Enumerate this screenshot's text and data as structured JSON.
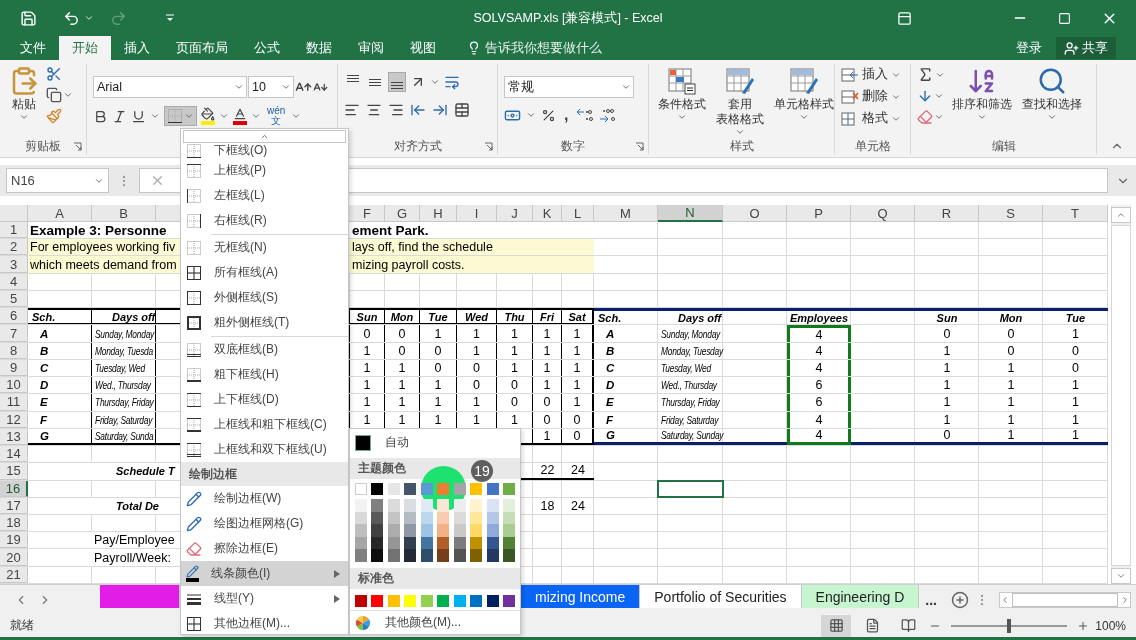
{
  "title": "SOLVSAMP.xls  [兼容模式] - Excel",
  "quick_access": {
    "redo_disabled": true
  },
  "menu_tabs": [
    {
      "label": "文件",
      "selected": false
    },
    {
      "label": "开始",
      "selected": true
    },
    {
      "label": "插入",
      "selected": false
    },
    {
      "label": "页面布局",
      "selected": false
    },
    {
      "label": "公式",
      "selected": false
    },
    {
      "label": "数据",
      "selected": false
    },
    {
      "label": "审阅",
      "selected": false
    },
    {
      "label": "视图",
      "selected": false
    }
  ],
  "tell_me": "告诉我你想要做什么",
  "sign_in": "登录",
  "share": "共享",
  "ribbon": {
    "groups": [
      {
        "kind": "clipboard",
        "label": "剪贴板",
        "paste": "粘贴"
      },
      {
        "kind": "font",
        "font": "Arial",
        "size": "10",
        "border_open": true,
        "phonetic": [
          "wén",
          "文"
        ]
      },
      {
        "kind": "alignment",
        "label": "对齐方式",
        "vertical_align": [
          {
            "selected": false
          },
          {
            "selected": false
          },
          {
            "selected": true
          }
        ]
      },
      {
        "kind": "number",
        "label": "数字",
        "format": "常规",
        "comma": ","
      },
      {
        "kind": "styles",
        "label": "样式",
        "buttons": [
          {
            "kind": "conditional",
            "lines": [
              "条件格式"
            ]
          },
          {
            "kind": "table",
            "lines": [
              "套用",
              "表格格式"
            ]
          },
          {
            "kind": "cell_style",
            "lines": [
              "单元格样式"
            ]
          }
        ]
      },
      {
        "kind": "cells",
        "label": "单元格",
        "items": [
          {
            "kind": "insert",
            "label": "插入"
          },
          {
            "kind": "delete",
            "label": "删除"
          },
          {
            "kind": "format",
            "label": "格式"
          }
        ]
      },
      {
        "kind": "editing",
        "label": "编辑",
        "buttons": [
          {
            "kind": "sort",
            "label": "排序和筛选"
          },
          {
            "kind": "find",
            "label": "查找和选择"
          }
        ]
      }
    ]
  },
  "name_box": "N16",
  "sheet": {
    "column_headers": [
      {
        "label": "A",
        "selected": false
      },
      {
        "label": "B",
        "selected": false
      },
      {
        "label": "F",
        "selected": false
      },
      {
        "label": "G",
        "selected": false
      },
      {
        "label": "H",
        "selected": false
      },
      {
        "label": "I",
        "selected": false
      },
      {
        "label": "J",
        "selected": false
      },
      {
        "label": "K",
        "selected": false
      },
      {
        "label": "L",
        "selected": false
      },
      {
        "label": "M",
        "selected": false
      },
      {
        "label": "N",
        "selected": true
      },
      {
        "label": "O",
        "selected": false
      },
      {
        "label": "P",
        "selected": false
      },
      {
        "label": "Q",
        "selected": false
      },
      {
        "label": "R",
        "selected": false
      },
      {
        "label": "S",
        "selected": false
      },
      {
        "label": "T",
        "selected": false
      }
    ],
    "rows": [
      {
        "header": "1",
        "selected": false,
        "kind": "title",
        "cells": [
          "Example 3:  Personne",
          null,
          "ement Park.",
          null,
          null,
          null,
          null,
          null,
          null,
          null,
          null,
          null,
          null,
          null,
          null,
          null,
          null
        ]
      },
      {
        "header": "2",
        "selected": false,
        "kind": "note",
        "cells": [
          "For employees working fiv",
          null,
          "lays off, find the schedule",
          null,
          null,
          null,
          null,
          null,
          null,
          null,
          null,
          null,
          null,
          null,
          null,
          null,
          null
        ]
      },
      {
        "header": "3",
        "selected": false,
        "kind": "note",
        "cells": [
          "which meets demand from",
          null,
          "mizing payroll costs.",
          null,
          null,
          null,
          null,
          null,
          null,
          null,
          null,
          null,
          null,
          null,
          null,
          null,
          null
        ]
      },
      {
        "header": "4",
        "selected": false,
        "kind": "blank"
      },
      {
        "header": "5",
        "selected": false,
        "kind": "blank"
      },
      {
        "header": "6",
        "selected": false,
        "kind": "header",
        "cells": [
          "Sch.",
          "Days off",
          "Sun",
          "Mon",
          "Tue",
          "Wed",
          "Thu",
          "Fri",
          "Sat",
          "Sch.",
          "Days off",
          null,
          "Employees",
          null,
          "Sun",
          "Mon",
          "Tue"
        ]
      },
      {
        "header": "7",
        "selected": false,
        "kind": "data",
        "cells": [
          "A",
          "Sunday, Monday",
          "0",
          "0",
          "1",
          "1",
          "1",
          "1",
          "1",
          "A",
          "Sunday, Monday",
          null,
          "4",
          null,
          "0",
          "0",
          "1"
        ]
      },
      {
        "header": "8",
        "selected": false,
        "kind": "data",
        "cells": [
          "B",
          "Monday, Tuesda",
          "1",
          "0",
          "0",
          "1",
          "1",
          "1",
          "1",
          "B",
          "Monday, Tuesday",
          null,
          "4",
          null,
          "1",
          "0",
          "0"
        ]
      },
      {
        "header": "9",
        "selected": false,
        "kind": "data",
        "cells": [
          "C",
          "Tuesday, Wed",
          "1",
          "1",
          "0",
          "0",
          "1",
          "1",
          "1",
          "C",
          "Tuesday, Wed",
          null,
          "4",
          null,
          "1",
          "1",
          "0"
        ]
      },
      {
        "header": "10",
        "selected": false,
        "kind": "data",
        "cells": [
          "D",
          "Wed., Thursday",
          "1",
          "1",
          "1",
          "0",
          "0",
          "1",
          "1",
          "D",
          "Wed., Thursday",
          null,
          "6",
          null,
          "1",
          "1",
          "1"
        ]
      },
      {
        "header": "11",
        "selected": false,
        "kind": "data",
        "cells": [
          "E",
          "Thursday, Friday",
          "1",
          "1",
          "1",
          "1",
          "0",
          "0",
          "1",
          "E",
          "Thursday, Friday",
          null,
          "6",
          null,
          "1",
          "1",
          "1"
        ]
      },
      {
        "header": "12",
        "selected": false,
        "kind": "data",
        "cells": [
          "F",
          "Friday, Saturday",
          "1",
          "1",
          "1",
          "1",
          "1",
          "0",
          "0",
          "F",
          "Friday, Saturday",
          null,
          "4",
          null,
          "1",
          "1",
          "1"
        ]
      },
      {
        "header": "13",
        "selected": false,
        "kind": "data",
        "cells": [
          "G",
          "Saturday, Sunda",
          null,
          null,
          null,
          null,
          null,
          "1",
          "0",
          "G",
          "Saturday, Sunday",
          null,
          "4",
          null,
          "0",
          "1",
          "1"
        ]
      },
      {
        "header": "14",
        "selected": false,
        "kind": "blank"
      },
      {
        "header": "15",
        "selected": false,
        "kind": "summary",
        "underlined": true,
        "cells": [
          null,
          "Schedule T",
          null,
          null,
          null,
          null,
          null,
          "22",
          "24",
          null,
          null,
          null,
          null,
          null,
          null,
          null,
          null
        ]
      },
      {
        "header": "16",
        "selected": true,
        "kind": "blank"
      },
      {
        "header": "17",
        "selected": false,
        "kind": "summary",
        "underlined": false,
        "cells": [
          null,
          "Total De",
          null,
          null,
          null,
          null,
          null,
          "18",
          "24",
          null,
          null,
          null,
          null,
          null,
          null,
          null,
          null
        ]
      },
      {
        "header": "18",
        "selected": false,
        "kind": "blank"
      },
      {
        "header": "19",
        "selected": false,
        "kind": "label",
        "cells": [
          null,
          "Pay/Employee",
          null,
          null,
          null,
          null,
          null,
          null,
          null,
          null,
          null,
          null,
          null,
          null,
          null,
          null,
          null
        ]
      },
      {
        "header": "20",
        "selected": false,
        "kind": "label",
        "cells": [
          null,
          "Payroll/Week:",
          null,
          null,
          null,
          null,
          null,
          null,
          null,
          null,
          null,
          null,
          null,
          null,
          null,
          null,
          null
        ]
      },
      {
        "header": "21",
        "selected": false,
        "kind": "blank"
      }
    ]
  },
  "sheet_tabs": [
    {
      "color": "#e21ee6"
    },
    {
      "label": "mizing Income",
      "color": "#0a64f5"
    },
    {
      "label": "Portfolio of Securities"
    },
    {
      "label": "Engineering D",
      "color": "#c6f5d0"
    }
  ],
  "tab_more": "...",
  "status": "就绪",
  "views": [
    {
      "selected": true
    },
    {
      "selected": false
    },
    {
      "selected": false
    }
  ],
  "zoom": {
    "level": 0.5,
    "reading": "100%"
  },
  "border_menu": [
    {
      "kind": "bottom",
      "label": "下框线(O)"
    },
    {
      "kind": "top",
      "label": "上框线(P)"
    },
    {
      "kind": "left",
      "label": "左框线(L)"
    },
    {
      "kind": "right",
      "label": "右框线(R)"
    },
    {
      "kind": "separator"
    },
    {
      "kind": "none",
      "label": "无框线(N)"
    },
    {
      "kind": "all",
      "label": "所有框线(A)"
    },
    {
      "kind": "outside",
      "label": "外侧框线(S)"
    },
    {
      "kind": "thick_outside",
      "label": "粗外侧框线(T)"
    },
    {
      "kind": "separator"
    },
    {
      "kind": "double_bottom",
      "label": "双底框线(B)"
    },
    {
      "kind": "thick_bottom",
      "label": "粗下框线(H)"
    },
    {
      "kind": "top_bottom",
      "label": "上下框线(D)"
    },
    {
      "kind": "top_thick_bottom",
      "label": "上框线和粗下框线(C)"
    },
    {
      "kind": "top_double_bottom",
      "label": "上框线和双下框线(U)"
    },
    {
      "kind": "section",
      "label": "绘制边框"
    },
    {
      "kind": "draw",
      "label": "绘制边框(W)"
    },
    {
      "kind": "draw_grid",
      "label": "绘图边框网格(G)"
    },
    {
      "kind": "erase",
      "label": "擦除边框(E)"
    },
    {
      "kind": "line_color",
      "label": "线条颜色(I)",
      "highlighted": true,
      "submenu": true
    },
    {
      "kind": "line_style",
      "label": "线型(Y)",
      "submenu": true
    },
    {
      "kind": "more",
      "label": "其他边框(M)..."
    }
  ],
  "color_picker": {
    "auto": "自动",
    "theme_header": "主题颜色",
    "theme_colors": [
      {
        "color": "#ffffff"
      },
      {
        "color": "#000000"
      },
      {
        "color": "#e7e6e6"
      },
      {
        "color": "#44546a"
      },
      {
        "color": "#5b9bd5"
      },
      {
        "color": "#ed7d31"
      },
      {
        "color": "#a5a5a5"
      },
      {
        "color": "#ffc000"
      },
      {
        "color": "#4472c4"
      },
      {
        "color": "#70ad47"
      }
    ],
    "standard_header": "标准色",
    "standard_colors": [
      {
        "color": "#c00000"
      },
      {
        "color": "#ff0000"
      },
      {
        "color": "#ffc000"
      },
      {
        "color": "#ffff00"
      },
      {
        "color": "#92d050"
      },
      {
        "color": "#00b050"
      },
      {
        "color": "#00b0f0"
      },
      {
        "color": "#0070c0"
      },
      {
        "color": "#002060"
      },
      {
        "color": "#7030a0"
      }
    ],
    "more": "其他颜色(M)..."
  },
  "click_marker": {
    "step": "19"
  }
}
